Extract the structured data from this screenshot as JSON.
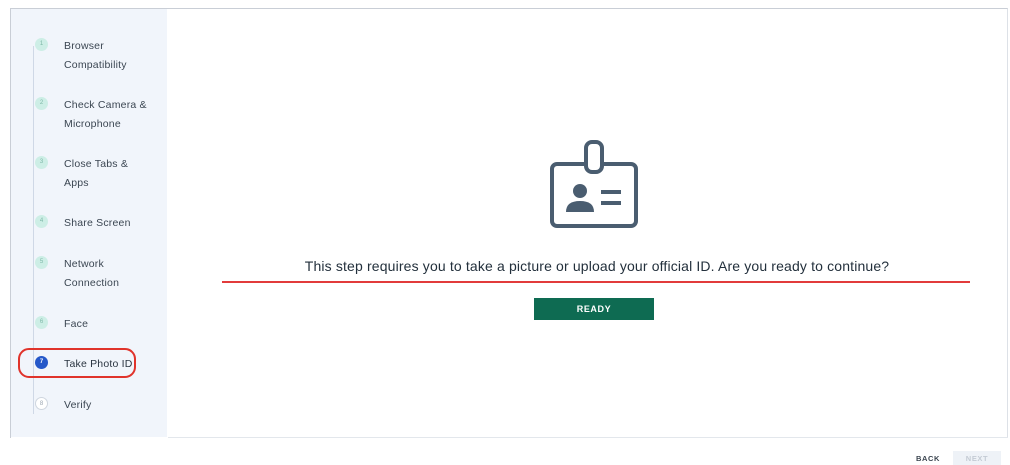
{
  "sidebar": {
    "steps": [
      {
        "number": "1",
        "label_line1": "Browser",
        "label_line2": "Compatibility",
        "state": "done"
      },
      {
        "number": "2",
        "label_line1": "Check Camera &",
        "label_line2": "Microphone",
        "state": "done"
      },
      {
        "number": "3",
        "label_line1": "Close Tabs &",
        "label_line2": "Apps",
        "state": "done"
      },
      {
        "number": "4",
        "label_line1": "Share Screen",
        "label_line2": "",
        "state": "done"
      },
      {
        "number": "5",
        "label_line1": "Network",
        "label_line2": "Connection",
        "state": "done"
      },
      {
        "number": "6",
        "label_line1": "Face",
        "label_line2": "",
        "state": "done"
      },
      {
        "number": "7",
        "label_line1": "Take Photo ID",
        "label_line2": "",
        "state": "active"
      },
      {
        "number": "8",
        "label_line1": "Verify",
        "label_line2": "",
        "state": "pending"
      }
    ]
  },
  "main": {
    "icon": "id-badge-icon",
    "prompt": "This step requires you to take a picture or upload your official ID. Are you ready to continue?",
    "ready_label": "READY"
  },
  "footer": {
    "back_label": "BACK",
    "next_label": "NEXT"
  },
  "colors": {
    "sidebar_bg": "#f1f5fb",
    "active_step": "#2558c9",
    "done_step": "#cdeee6",
    "primary_button": "#0e6b52",
    "annotation_red": "#e0332b",
    "icon_stroke": "#4a5d70"
  }
}
